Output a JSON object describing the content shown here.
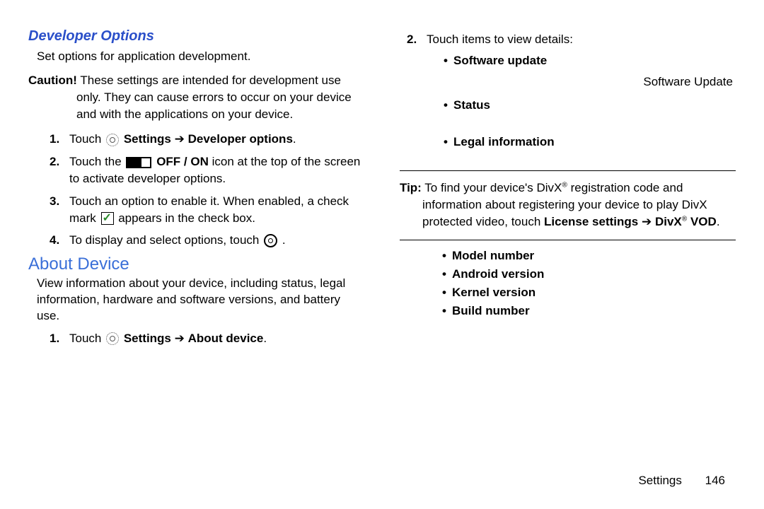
{
  "left": {
    "heading1": "Developer Options",
    "intro": "Set options for application development.",
    "caution_label": "Caution!",
    "caution_l1": "These settings are intended for development use",
    "caution_l2": "only. They can cause errors to occur on your device and with the applications on your device.",
    "steps": [
      {
        "n": "1.",
        "pre": "Touch ",
        "b1": "Settings",
        "sep": " ➔ ",
        "b2": "Developer options",
        "post": "."
      },
      {
        "n": "2.",
        "pre": "Touch the ",
        "b1": "OFF / ON",
        "post": " icon at the top of the screen to activate developer options."
      },
      {
        "n": "3.",
        "pre": "Touch an option to enable it. When enabled, a check mark ",
        "post": " appears in the check box."
      },
      {
        "n": "4.",
        "pre": "To display and select options, touch ",
        "post": " ."
      }
    ],
    "heading2": "About Device",
    "about_desc": "View information about your device, including status, legal information, hardware and software versions, and battery use.",
    "about_step": {
      "n": "1.",
      "pre": "Touch ",
      "b1": "Settings",
      "sep": " ➔ ",
      "b2": "About device",
      "post": "."
    }
  },
  "right": {
    "step2": {
      "n": "2.",
      "text": "Touch items to view details:"
    },
    "items1": [
      "Software update",
      "Status",
      "Legal information"
    ],
    "subnote": "Software Update",
    "tip_label": "Tip:",
    "tip_l1": "To find your device's DivX",
    "tip_l1b": " registration code and",
    "tip_l2a": "information about registering your device to play DivX protected video, touch ",
    "tip_bold1": "License settings",
    "tip_sep": " ➔ ",
    "tip_bold2": "DivX",
    "tip_bold3": " VOD",
    "items2": [
      "Model number",
      "Android version",
      "Kernel version",
      "Build number"
    ]
  },
  "footer": {
    "section": "Settings",
    "page": "146"
  }
}
